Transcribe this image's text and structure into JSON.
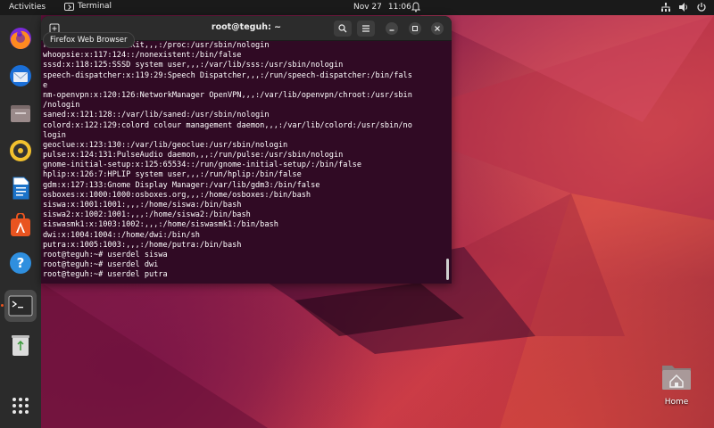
{
  "topbar": {
    "activities": "Activities",
    "app_name": "Terminal",
    "date": "Nov 27",
    "time": "11:06"
  },
  "dock": {
    "tooltip": "Firefox Web Browser",
    "items": [
      "firefox-icon",
      "thunderbird-icon",
      "files-icon",
      "rhythmbox-icon",
      "writer-icon",
      "app-center-icon",
      "help-icon",
      "terminal-icon",
      "trash-icon",
      "app-grid-icon"
    ]
  },
  "terminal": {
    "title": "root@teguh: ~",
    "lines": [
      "r.........:realtimeKit,,,:/proc:/usr/sbin/nologin",
      "whoopsie:x:117:124::/nonexistent:/bin/false",
      "sssd:x:118:125:SSSD system user,,,:/var/lib/sss:/usr/sbin/nologin",
      "speech-dispatcher:x:119:29:Speech Dispatcher,,,:/run/speech-dispatcher:/bin/fals",
      "e",
      "nm-openvpn:x:120:126:NetworkManager OpenVPN,,,:/var/lib/openvpn/chroot:/usr/sbin",
      "/nologin",
      "saned:x:121:128::/var/lib/saned:/usr/sbin/nologin",
      "colord:x:122:129:colord colour management daemon,,,:/var/lib/colord:/usr/sbin/no",
      "login",
      "geoclue:x:123:130::/var/lib/geoclue:/usr/sbin/nologin",
      "pulse:x:124:131:PulseAudio daemon,,,:/run/pulse:/usr/sbin/nologin",
      "gnome-initial-setup:x:125:65534::/run/gnome-initial-setup/:/bin/false",
      "hplip:x:126:7:HPLIP system user,,,:/run/hplip:/bin/false",
      "gdm:x:127:133:Gnome Display Manager:/var/lib/gdm3:/bin/false",
      "osboxes:x:1000:1000:osboxes.org,,,:/home/osboxes:/bin/bash",
      "siswa:x:1001:1001:,,,:/home/siswa:/bin/bash",
      "siswa2:x:1002:1001:,,,:/home/siswa2:/bin/bash",
      "siswasmk1:x:1003:1002:,,,:/home/siswasmk1:/bin/bash",
      "dwi:x:1004:1004::/home/dwi:/bin/sh",
      "putra:x:1005:1003:,,,:/home/putra:/bin/bash",
      "root@teguh:~# userdel siswa",
      "root@teguh:~# userdel dwi",
      "root@teguh:~# userdel putra"
    ]
  },
  "desktop": {
    "home_label": "Home"
  },
  "colors": {
    "terminal_bg": "#300a24",
    "header_bg": "#2c2c2c",
    "dock_bg": "#2b2b2b",
    "accent": "#e95420"
  }
}
